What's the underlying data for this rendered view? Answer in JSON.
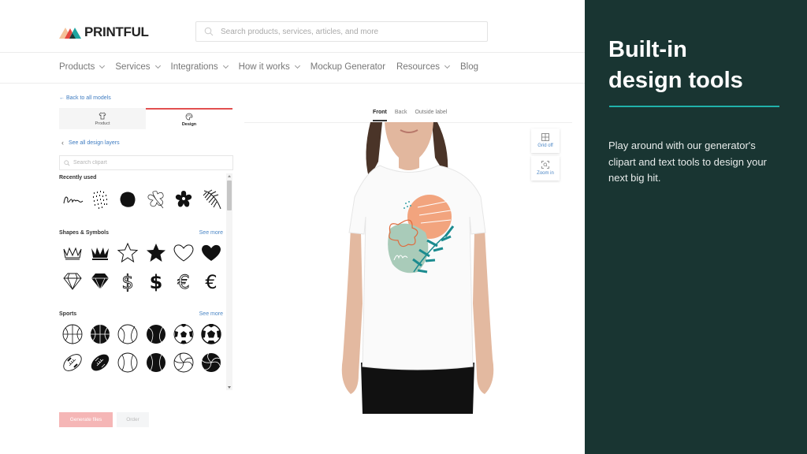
{
  "brand": {
    "name": "PRINTFUL",
    "colors": {
      "peach": "#f4c29a",
      "red": "#e5483f",
      "teal": "#1ea5a0",
      "dark": "#1e3b38"
    }
  },
  "header": {
    "search_placeholder": "Search products, services, articles, and more",
    "nav": [
      {
        "label": "Products",
        "has_dropdown": true
      },
      {
        "label": "Services",
        "has_dropdown": true
      },
      {
        "label": "Integrations",
        "has_dropdown": true
      },
      {
        "label": "How it works",
        "has_dropdown": true
      },
      {
        "label": "Mockup Generator",
        "has_dropdown": false
      },
      {
        "label": "Resources",
        "has_dropdown": true
      },
      {
        "label": "Blog",
        "has_dropdown": false
      }
    ]
  },
  "sidebar": {
    "back_link": "← Back to all models",
    "tabs": [
      {
        "label": "Product",
        "icon": "tshirt-icon",
        "active": false
      },
      {
        "label": "Design",
        "icon": "palette-icon",
        "active": true
      }
    ],
    "layers_link": "See all design layers",
    "clip_search_placeholder": "Search clipart",
    "sections": [
      {
        "title": "Recently used",
        "see_more": "",
        "icons": [
          "scribble",
          "dots",
          "blob",
          "hibiscus-outline",
          "flower-filled",
          "palm-leaf"
        ]
      },
      {
        "title": "Shapes & Symbols",
        "see_more": "See more",
        "icons": [
          "crown-outline",
          "crown-filled",
          "star-outline",
          "star-filled",
          "heart-outline",
          "heart-filled",
          "diamond-outline",
          "diamond-filled",
          "dollar-outline",
          "dollar-filled",
          "euro-outline",
          "euro-filled"
        ]
      },
      {
        "title": "Sports",
        "see_more": "See more",
        "icons": [
          "basketball-outline",
          "basketball-filled",
          "tennis-outline",
          "tennis-filled",
          "soccer-outline",
          "soccer-filled",
          "football-outline",
          "football-filled",
          "baseball-outline",
          "baseball-filled",
          "volleyball-outline",
          "volleyball-filled"
        ]
      }
    ],
    "generate_label": "Generate files",
    "order_label": "Order"
  },
  "preview": {
    "view_tabs": [
      {
        "label": "Front",
        "active": true
      },
      {
        "label": "Back",
        "active": false
      },
      {
        "label": "Outside label",
        "active": false
      }
    ],
    "tools": [
      {
        "label": "Grid off",
        "icon": "grid-icon"
      },
      {
        "label": "Zoom in",
        "icon": "zoom-in-icon"
      }
    ]
  },
  "promo": {
    "title_line1": "Built-in",
    "title_line2": "design tools",
    "body": "Play around with our generator's clipart and text tools to design your next big hit.",
    "accent": "#20b2aa",
    "background": "#193532"
  }
}
